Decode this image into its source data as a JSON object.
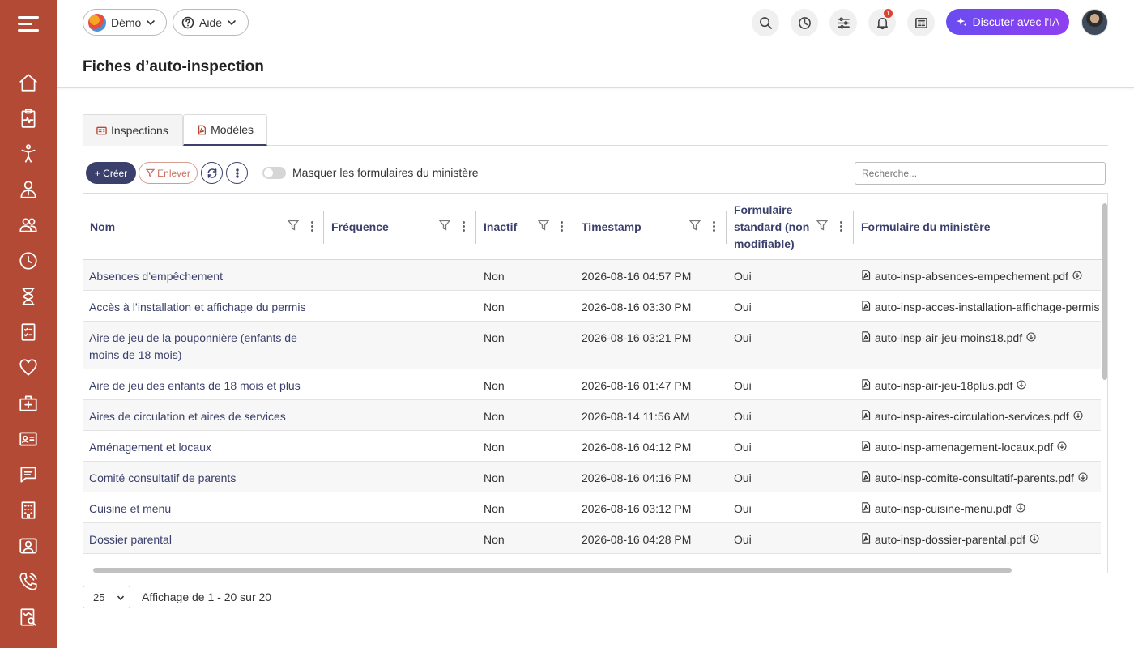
{
  "header": {
    "org_label": "Démo",
    "help_label": "Aide",
    "notifications_count": "1",
    "ai_button_label": "Discuter avec l'IA"
  },
  "page": {
    "title": "Fiches d’auto-inspection"
  },
  "tabs": [
    {
      "label": "Inspections",
      "icon": "id-card-icon",
      "active": false
    },
    {
      "label": "Modèles",
      "icon": "pdf-file-icon",
      "active": true
    }
  ],
  "toolbar": {
    "create_label": "+ Créer",
    "remove_label": "Enlever",
    "toggle_label": "Masquer les formulaires du ministère",
    "search_placeholder": "Recherche..."
  },
  "table": {
    "columns": [
      "Nom",
      "Fréquence",
      "Inactif",
      "Timestamp",
      "Formulaire standard (non modifiable)",
      "Formulaire du ministère"
    ],
    "rows": [
      {
        "name": "Absences d’empêchement",
        "frequency": "",
        "inactive": "Non",
        "timestamp": "2026-08-16 04:57 PM",
        "standard": "Oui",
        "file": "auto-insp-absences-empechement.pdf"
      },
      {
        "name": "Accès à l’installation et affichage du permis",
        "frequency": "",
        "inactive": "Non",
        "timestamp": "2026-08-16 03:30 PM",
        "standard": "Oui",
        "file": "auto-insp-acces-installation-affichage-permis"
      },
      {
        "name": "Aire de jeu de la pouponnière (enfants de moins de 18 mois)",
        "frequency": "",
        "inactive": "Non",
        "timestamp": "2026-08-16 03:21 PM",
        "standard": "Oui",
        "file": "auto-insp-air-jeu-moins18.pdf"
      },
      {
        "name": "Aire de jeu des enfants de 18 mois et plus",
        "frequency": "",
        "inactive": "Non",
        "timestamp": "2026-08-16 01:47 PM",
        "standard": "Oui",
        "file": "auto-insp-air-jeu-18plus.pdf"
      },
      {
        "name": "Aires de circulation et aires de services",
        "frequency": "",
        "inactive": "Non",
        "timestamp": "2026-08-14 11:56 AM",
        "standard": "Oui",
        "file": "auto-insp-aires-circulation-services.pdf"
      },
      {
        "name": "Aménagement et locaux",
        "frequency": "",
        "inactive": "Non",
        "timestamp": "2026-08-16 04:12 PM",
        "standard": "Oui",
        "file": "auto-insp-amenagement-locaux.pdf"
      },
      {
        "name": "Comité consultatif de parents",
        "frequency": "",
        "inactive": "Non",
        "timestamp": "2026-08-16 04:16 PM",
        "standard": "Oui",
        "file": "auto-insp-comite-consultatif-parents.pdf"
      },
      {
        "name": "Cuisine et menu",
        "frequency": "",
        "inactive": "Non",
        "timestamp": "2026-08-16 03:12 PM",
        "standard": "Oui",
        "file": "auto-insp-cuisine-menu.pdf"
      },
      {
        "name": "Dossier parental",
        "frequency": "",
        "inactive": "Non",
        "timestamp": "2026-08-16 04:28 PM",
        "standard": "Oui",
        "file": "auto-insp-dossier-parental.pdf"
      }
    ]
  },
  "pager": {
    "page_size": "25",
    "info": "Affichage de 1 - 20 sur 20"
  }
}
